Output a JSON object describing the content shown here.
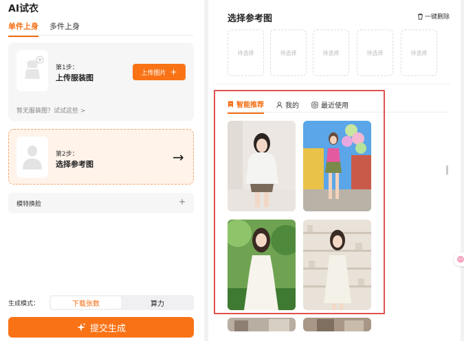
{
  "app": {
    "title": "AI试衣"
  },
  "tabs": [
    {
      "label": "单件上身",
      "active": true
    },
    {
      "label": "多件上身",
      "active": false
    }
  ],
  "step1": {
    "step_label": "第1步：",
    "title": "上传服装图",
    "upload_label": "上传图片",
    "hint": "暂无服装图？试试这些 >"
  },
  "step2": {
    "step_label": "第2步：",
    "title": "选择参考图",
    "arrow": "→"
  },
  "face_swap": {
    "label": "模特换脸",
    "plus": "+"
  },
  "mode": {
    "label": "生成模式：",
    "options": [
      "下载张数",
      "算力"
    ],
    "selected": "下载张数"
  },
  "submit": {
    "label": "提交生成",
    "icon": "sparkle-icon"
  },
  "reference": {
    "title": "选择参考图",
    "clear_label": "一键删除",
    "slots": [
      "待选择",
      "待选择",
      "待选择",
      "待选择",
      "待选择"
    ]
  },
  "ref_tabs": [
    {
      "label": "智能推荐",
      "icon": "bookmark-icon",
      "active": true
    },
    {
      "label": "我的",
      "icon": "user-icon",
      "active": false
    },
    {
      "label": "最近使用",
      "icon": "recent-icon",
      "active": false
    }
  ],
  "photos": [
    {
      "name": "photo-girl-hoodie"
    },
    {
      "name": "photo-girl-balloons"
    },
    {
      "name": "photo-girl-white-dress-garden"
    },
    {
      "name": "photo-girl-white-dress-shelves"
    },
    {
      "name": "photo-partial-1"
    },
    {
      "name": "photo-partial-2"
    }
  ],
  "colors": {
    "accent": "#f97316",
    "accent_text": "#f36d10",
    "highlight_border": "#e05050",
    "step2_bg": "#fff3ea"
  }
}
